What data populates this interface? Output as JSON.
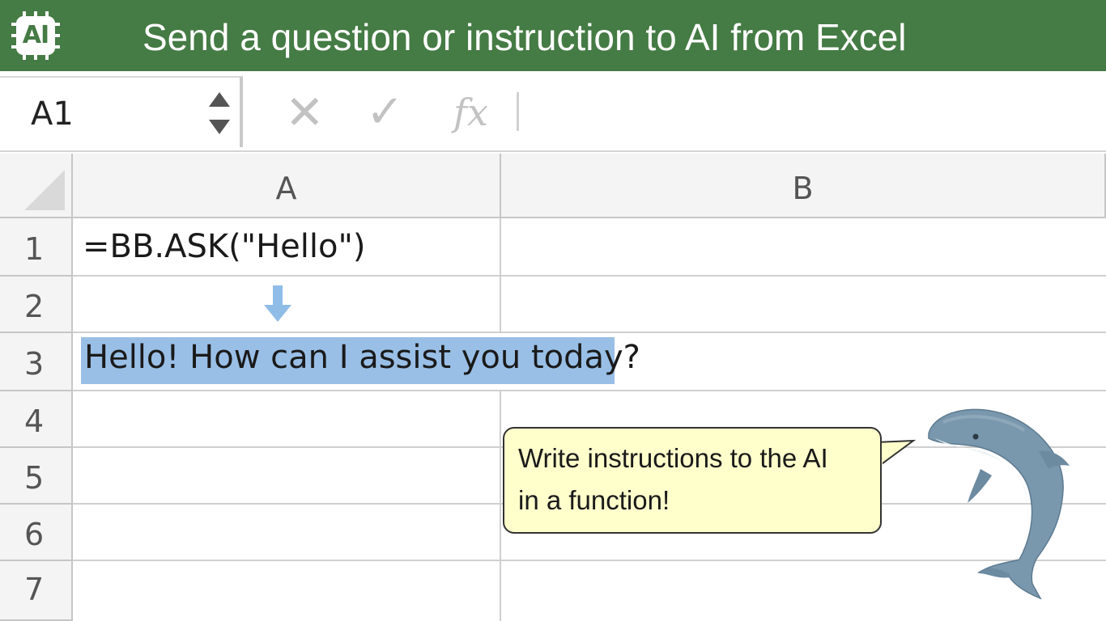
{
  "title": "Send a question or instruction to AI from Excel",
  "app_icon": {
    "name": "ai-chip-icon",
    "text": "AI"
  },
  "name_box": {
    "value": "A1"
  },
  "formula_bar": {
    "cancel_icon": "close-icon",
    "enter_icon": "checkmark-icon",
    "fx_label": "fx",
    "content": ""
  },
  "columns": [
    "A",
    "B"
  ],
  "rows": [
    "1",
    "2",
    "3",
    "4",
    "5",
    "6",
    "7"
  ],
  "cells": {
    "A1": "=BB.ASK(\"Hello\")",
    "A3": "Hello! How can I assist you today?"
  },
  "callout": {
    "line1": "Write instructions to the AI",
    "line2": "in a function!"
  },
  "colors": {
    "title_bar": "#457b44",
    "highlight": "#99bfe6",
    "arrow": "#8fbde8",
    "callout_bg": "#ffffcc"
  }
}
